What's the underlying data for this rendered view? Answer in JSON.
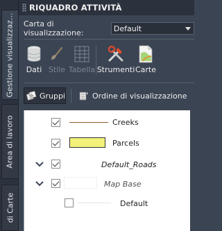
{
  "window": {
    "title": "RIQUADRO ATTIVITÀ"
  },
  "side_tabs": [
    {
      "label": "Gestione visualizzaz..."
    },
    {
      "label": "Area di lavoro"
    },
    {
      "label": "di Carte"
    }
  ],
  "map_selector": {
    "label": "Carta di visualizzazione:",
    "value": "Default"
  },
  "toolbar": {
    "items": [
      {
        "label": "Dati",
        "icon": "database-icon",
        "enabled": true
      },
      {
        "label": "Stile",
        "icon": "brush-icon",
        "enabled": false
      },
      {
        "label": "Tabella",
        "icon": "table-icon",
        "enabled": false
      },
      {
        "label": "Strumenti",
        "icon": "tools-icon",
        "enabled": true
      },
      {
        "label": "Carte",
        "icon": "map-icon",
        "enabled": true
      }
    ]
  },
  "tabs": [
    {
      "label": "Gruppi",
      "icon": "groups-icon",
      "active": true
    },
    {
      "label": "Ordine di visualizzazione",
      "icon": "draw-order-icon",
      "active": false
    }
  ],
  "layers": [
    {
      "name": "Creeks",
      "checked": true,
      "style": "line",
      "color": "#8b5a2b",
      "expandable": false
    },
    {
      "name": "Parcels",
      "checked": true,
      "style": "polygon",
      "color": "#f2f27a",
      "expandable": false
    },
    {
      "name": "Default_Roads",
      "checked": true,
      "style": "none",
      "expandable": true
    },
    {
      "name": "Map Base",
      "checked": true,
      "style": "blank",
      "expandable": true
    },
    {
      "name": "Default",
      "checked": false,
      "style": "blank-line",
      "expandable": false
    }
  ]
}
